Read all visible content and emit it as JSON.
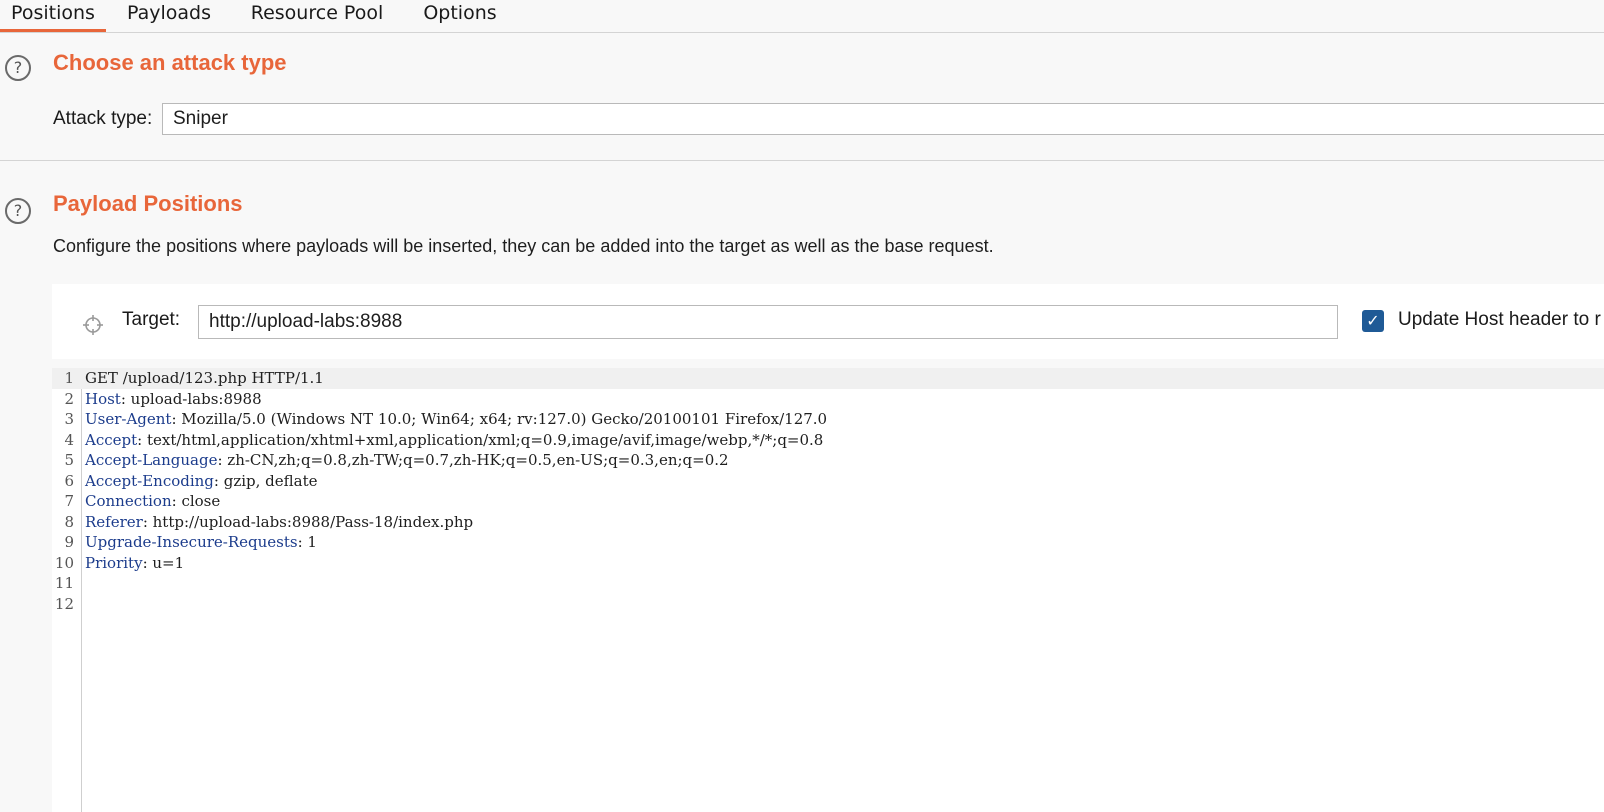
{
  "tabs": [
    {
      "label": "Positions",
      "active": true
    },
    {
      "label": "Payloads",
      "active": false
    },
    {
      "label": "Resource Pool",
      "active": false
    },
    {
      "label": "Options",
      "active": false
    }
  ],
  "attack_section": {
    "help_icon": "?",
    "title": "Choose an attack type",
    "attack_type_label": "Attack type:",
    "attack_type_value": "Sniper"
  },
  "positions_section": {
    "help_icon": "?",
    "title": "Payload Positions",
    "description": "Configure the positions where payloads will be inserted, they can be added into the target as well as the base request.",
    "target_label": "Target:",
    "target_value": "http://upload-labs:8988",
    "update_host_checked": true,
    "update_host_label": "Update Host header to r"
  },
  "request_lines": [
    {
      "num": "1",
      "name": "",
      "value": "GET /upload/123.php HTTP/1.1"
    },
    {
      "num": "2",
      "name": "Host",
      "value": ": upload-labs:8988"
    },
    {
      "num": "3",
      "name": "User-Agent",
      "value": ": Mozilla/5.0 (Windows NT 10.0; Win64; x64; rv:127.0) Gecko/20100101 Firefox/127.0"
    },
    {
      "num": "4",
      "name": "Accept",
      "value": ": text/html,application/xhtml+xml,application/xml;q=0.9,image/avif,image/webp,*/*;q=0.8"
    },
    {
      "num": "5",
      "name": "Accept-Language",
      "value": ": zh-CN,zh;q=0.8,zh-TW;q=0.7,zh-HK;q=0.5,en-US;q=0.3,en;q=0.2"
    },
    {
      "num": "6",
      "name": "Accept-Encoding",
      "value": ": gzip, deflate"
    },
    {
      "num": "7",
      "name": "Connection",
      "value": ": close"
    },
    {
      "num": "8",
      "name": "Referer",
      "value": ": http://upload-labs:8988/Pass-18/index.php"
    },
    {
      "num": "9",
      "name": "Upgrade-Insecure-Requests",
      "value": ": 1"
    },
    {
      "num": "10",
      "name": "Priority",
      "value": ": u=1"
    },
    {
      "num": "11",
      "name": "",
      "value": ""
    },
    {
      "num": "12",
      "name": "",
      "value": ""
    }
  ],
  "colors": {
    "accent": "#e8663a",
    "header_name": "#1c3c8c",
    "checkbox": "#1f5a96"
  }
}
